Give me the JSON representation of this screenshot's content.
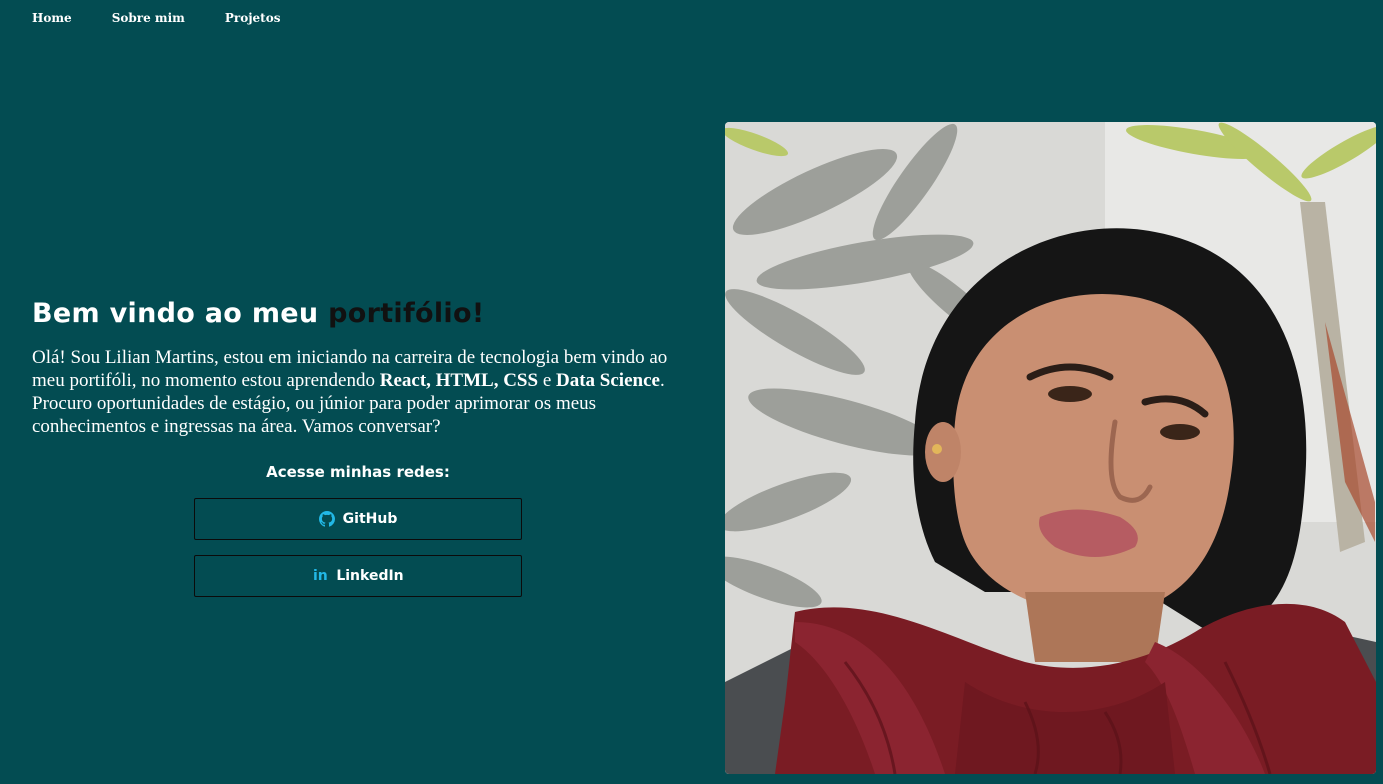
{
  "nav": {
    "items": [
      {
        "label": "Home"
      },
      {
        "label": "Sobre mim"
      },
      {
        "label": "Projetos"
      }
    ]
  },
  "hero": {
    "headline_main": "Bem vindo ao meu ",
    "headline_accent": "portifólio!",
    "bio": {
      "part1": "Olá! Sou Lilian Martins, estou em iniciando na carreira de tecnologia bem vindo ao meu portifóli, no momento estou aprendendo ",
      "bold1": "React, HTML, CSS",
      "part2": " e ",
      "bold2": "Data Science",
      "part3": ". Procuro oportunidades de estágio, ou júnior para poder aprimorar os meus conhecimentos e ingressas na área. Vamos conversar?"
    },
    "social_title": "Acesse minhas redes:",
    "buttons": {
      "github": "GitHub",
      "linkedin": "LinkedIn",
      "linkedin_icon_text": "in"
    }
  },
  "colors": {
    "background": "#034c52",
    "accent_text": "#111111",
    "icon": "#22b8e6"
  },
  "icons": [
    "github-icon",
    "linkedin-icon"
  ]
}
